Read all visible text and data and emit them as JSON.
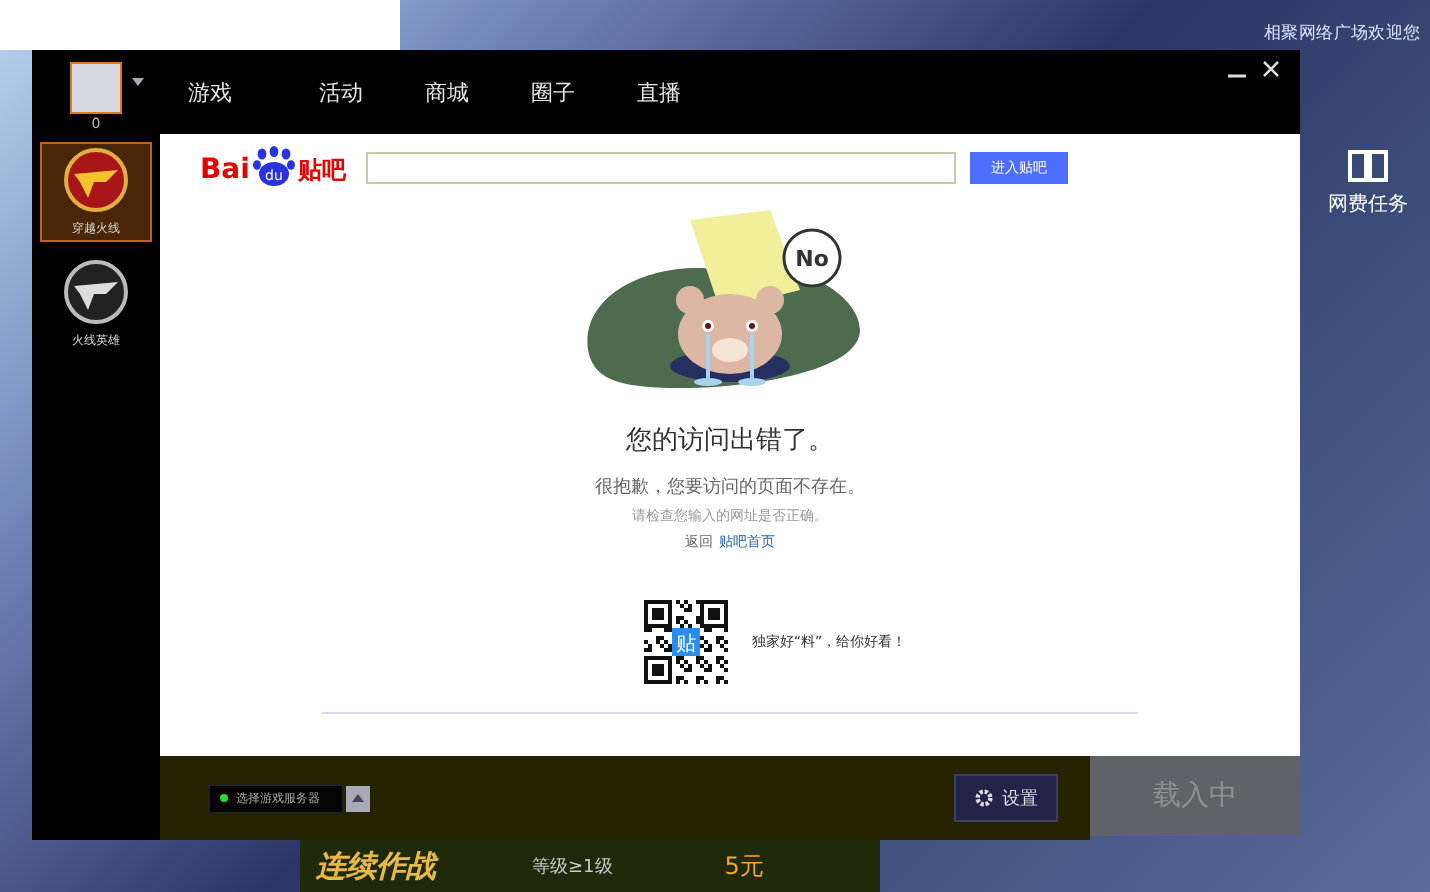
{
  "desktop": {
    "welcome": "相聚网络广场欢迎您",
    "side_task": "网费任务",
    "loading": "载入中",
    "promo": {
      "title": "连续作战",
      "level": "等级≥1级",
      "price": "5元"
    }
  },
  "window": {
    "avatar_label": "0",
    "nav": [
      "游戏",
      "活动",
      "商城",
      "圈子",
      "直播"
    ]
  },
  "sidebar": [
    {
      "label": "穿越火线",
      "selected": true
    },
    {
      "label": "火线英雄",
      "selected": false
    }
  ],
  "page": {
    "logo": [
      "Bai",
      "du",
      "贴吧"
    ],
    "search_button": "进入贴吧",
    "bubble": "No",
    "title": "您的访问出错了。",
    "message": "很抱歉，您要访问的页面不存在。",
    "hint": "请检查您输入的网址是否正确。",
    "back_prefix": "返回",
    "back_link": "贴吧首页",
    "qr_badge": "贴",
    "slogan": "独家好“料”，给你好看！"
  },
  "footer": {
    "server": {
      "label": "选择游戏服务器",
      "online": true
    },
    "settings": "设置"
  }
}
